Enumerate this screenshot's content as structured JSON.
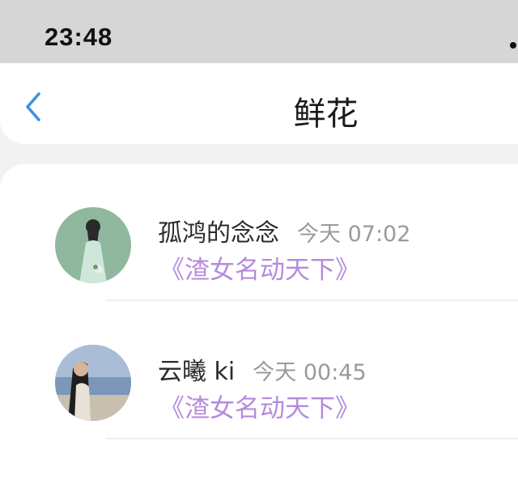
{
  "status_bar": {
    "time": "23:48"
  },
  "nav": {
    "title": "鲜花"
  },
  "conversations": [
    {
      "name": "孤鸿的念念",
      "time": "今天 07:02",
      "message": "《渣女名动天下》"
    },
    {
      "name": "云曦 ki",
      "time": "今天 00:45",
      "message": "《渣女名动天下》"
    }
  ],
  "colors": {
    "accent_blue": "#3b8fe8",
    "message_purple": "#b48bdc"
  },
  "icons": [
    "back-chevron-icon"
  ]
}
